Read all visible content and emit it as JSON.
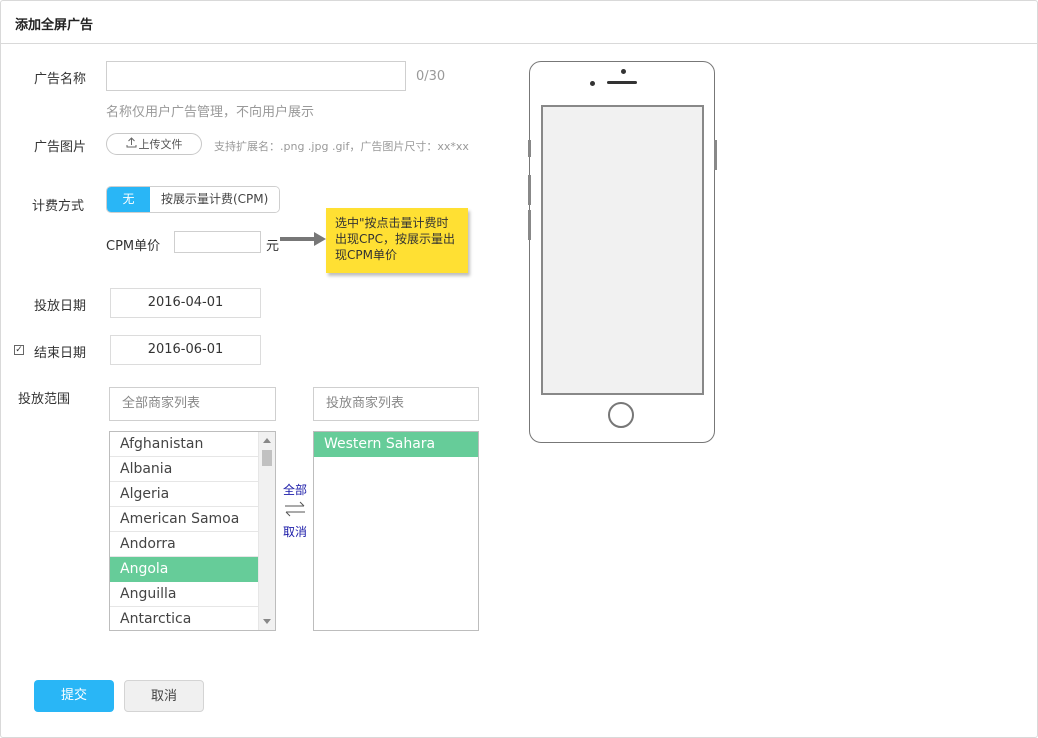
{
  "header": {
    "title": "添加全屏广告"
  },
  "form": {
    "name_label": "广告名称",
    "name_value": "",
    "name_counter": "0/30",
    "name_hint": "名称仅用户广告管理，不向用户展示",
    "image_label": "广告图片",
    "upload_label": "上传文件",
    "upload_hint": "支持扩展名：.png .jpg .gif，广告图片尺寸：xx*xx",
    "billing_label": "计费方式",
    "billing_options": [
      "无",
      "按展示量计费(CPM)"
    ],
    "billing_selected": "无",
    "cpm_label": "CPM单价",
    "cpm_value": "",
    "cpm_unit": "元",
    "note": "选中\"按点击量计费时出现CPC，按展示量出现CPM单价",
    "start_label": "投放日期",
    "start_date": "2016-04-01",
    "end_label": "结束日期",
    "end_checked": true,
    "end_date": "2016-06-01",
    "range_label": "投放范围",
    "all_placeholder": "全部商家列表",
    "target_placeholder": "投放商家列表",
    "all_list": [
      "Afghanistan",
      "Albania",
      "Algeria",
      "American Samoa",
      "Andorra",
      "Angola",
      "Anguilla",
      "Antarctica"
    ],
    "all_list_selected": "Angola",
    "target_list": [
      "Western Sahara"
    ],
    "transfer_all": "全部",
    "transfer_cancel": "取消",
    "submit_label": "提交",
    "cancel_label": "取消"
  },
  "colors": {
    "primary": "#29b6f6",
    "selected_row": "#66cc99",
    "note_bg": "#ffe033",
    "link": "#1a1aa8"
  }
}
